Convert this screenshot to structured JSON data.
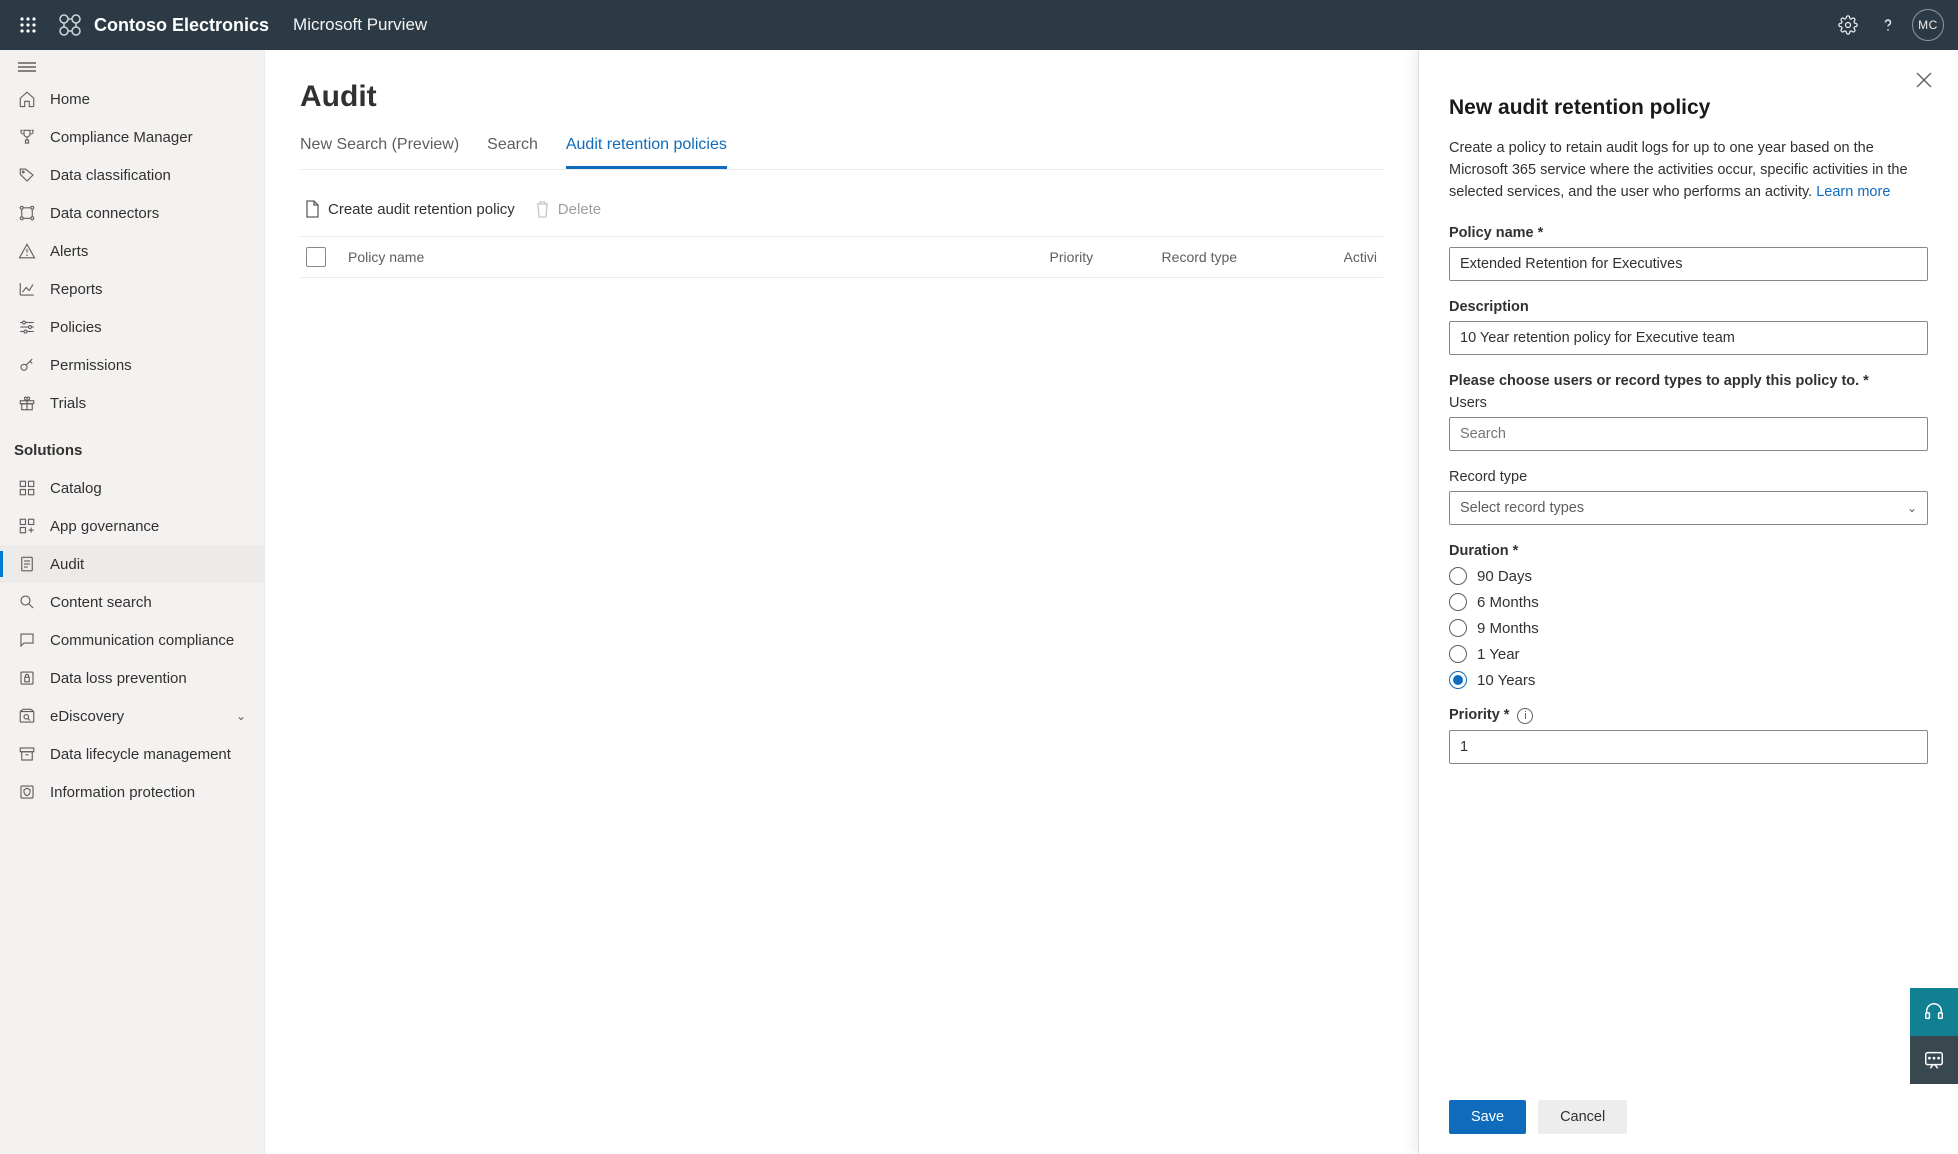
{
  "header": {
    "org": "Contoso Electronics",
    "product": "Microsoft Purview",
    "avatar_initials": "MC"
  },
  "sidebar": {
    "top": [
      {
        "label": "Home"
      },
      {
        "label": "Compliance Manager"
      },
      {
        "label": "Data classification"
      },
      {
        "label": "Data connectors"
      },
      {
        "label": "Alerts"
      },
      {
        "label": "Reports"
      },
      {
        "label": "Policies"
      },
      {
        "label": "Permissions"
      },
      {
        "label": "Trials"
      }
    ],
    "solutions_header": "Solutions",
    "solutions": [
      {
        "label": "Catalog"
      },
      {
        "label": "App governance"
      },
      {
        "label": "Audit",
        "active": true
      },
      {
        "label": "Content search"
      },
      {
        "label": "Communication compliance"
      },
      {
        "label": "Data loss prevention"
      },
      {
        "label": "eDiscovery",
        "expandable": true
      },
      {
        "label": "Data lifecycle management"
      },
      {
        "label": "Information protection"
      }
    ]
  },
  "page": {
    "title": "Audit",
    "tabs": [
      {
        "label": "New Search (Preview)"
      },
      {
        "label": "Search"
      },
      {
        "label": "Audit retention policies",
        "active": true
      }
    ],
    "toolbar": {
      "create": "Create audit retention policy",
      "delete": "Delete"
    },
    "columns": {
      "name": "Policy name",
      "priority": "Priority",
      "record": "Record type",
      "activities": "Activi"
    }
  },
  "flyout": {
    "title": "New audit retention policy",
    "desc": "Create a policy to retain audit logs for up to one year based on the Microsoft 365 service where the activities occur, specific activities in the selected services, and the user who performs an activity. ",
    "learn_more": "Learn more",
    "labels": {
      "policy_name": "Policy name *",
      "description": "Description",
      "scope": "Please choose users or record types to apply this policy to. *",
      "users": "Users",
      "users_placeholder": "Search",
      "record_type": "Record type",
      "record_placeholder": "Select record types",
      "duration": "Duration *",
      "priority": "Priority *"
    },
    "values": {
      "policy_name": "Extended Retention for Executives",
      "description": "10 Year retention policy for Executive team",
      "priority": "1"
    },
    "duration_options": [
      {
        "label": "90 Days"
      },
      {
        "label": "6 Months"
      },
      {
        "label": "9 Months"
      },
      {
        "label": "1 Year"
      },
      {
        "label": "10 Years",
        "selected": true
      }
    ],
    "buttons": {
      "save": "Save",
      "cancel": "Cancel"
    }
  }
}
